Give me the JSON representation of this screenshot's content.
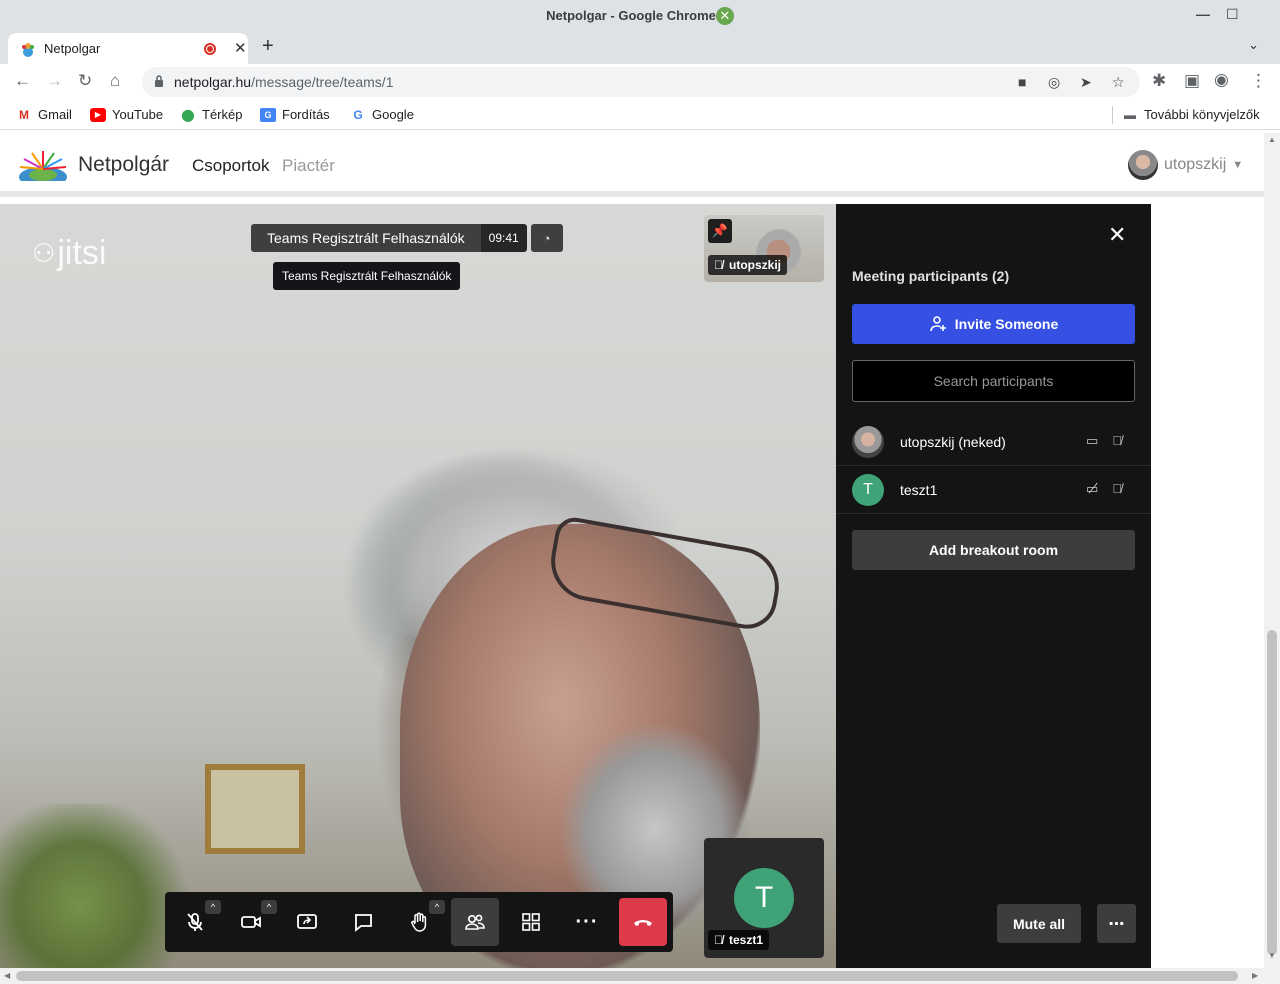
{
  "window": {
    "title": "Netpolgar - Google Chrome"
  },
  "tab": {
    "title": "Netpolgar"
  },
  "address": {
    "host": "netpolgar.hu",
    "path": "/message/tree/teams/1"
  },
  "bookmarks": [
    {
      "label": "Gmail",
      "icon": "gmail-icon",
      "color": "#d93025"
    },
    {
      "label": "YouTube",
      "icon": "youtube-icon",
      "color": "#ff0000"
    },
    {
      "label": "Térkép",
      "icon": "maps-icon",
      "color": "#34a853"
    },
    {
      "label": "Fordítás",
      "icon": "translate-icon",
      "color": "#4285f4"
    },
    {
      "label": "Google",
      "icon": "google-icon",
      "color": "#4285f4"
    }
  ],
  "bookmarks_other": "További könyvjelzők",
  "site": {
    "brand": "Netpolgár",
    "menu": [
      "Csoportok",
      "Piactér"
    ],
    "user": "utopszkij"
  },
  "meeting": {
    "logo": "jitsi",
    "subject": "Teams Regisztrált Felhasználók",
    "timer": "09:41",
    "tooltip": "Teams Regisztrált Felhasználók",
    "thumb_local": "utopszkij",
    "thumb_remote": "teszt1",
    "thumb_remote_initial": "T"
  },
  "panel": {
    "heading": "Meeting participants (2)",
    "invite": "Invite Someone",
    "search_placeholder": "Search participants",
    "participants": [
      {
        "name": "utopszkij (neked)",
        "initial": ""
      },
      {
        "name": "teszt1",
        "initial": "T"
      }
    ],
    "breakout": "Add breakout room",
    "mute_all": "Mute all",
    "more": "⋯"
  },
  "colors": {
    "invite": "#3550e3",
    "hangup": "#dd3a4b",
    "avatar_t": "#3fa377"
  }
}
